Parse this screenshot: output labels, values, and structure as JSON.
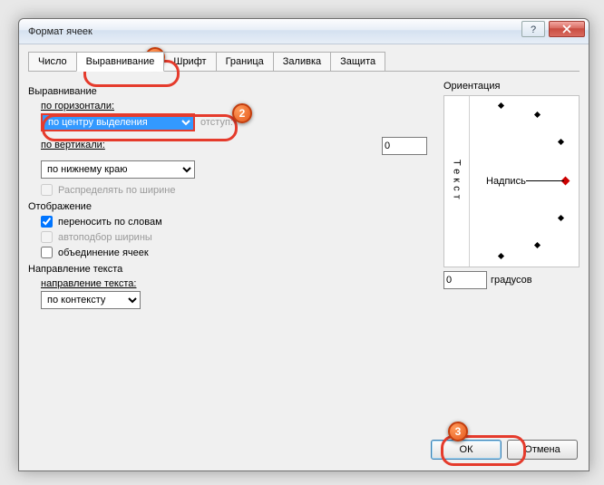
{
  "window": {
    "title": "Формат ячеек"
  },
  "tabs": [
    "Число",
    "Выравнивание",
    "Шрифт",
    "Граница",
    "Заливка",
    "Защита"
  ],
  "active_tab_index": 1,
  "align": {
    "group": "Выравнивание",
    "h_label": "по горизонтали:",
    "h_value": "по центру выделения",
    "indent_label": "отступ:",
    "indent_value": "0",
    "v_label": "по вертикали:",
    "v_value": "по нижнему краю",
    "justify_label": "Распределять по ширине"
  },
  "display": {
    "group": "Отображение",
    "wrap_label": "переносить по словам",
    "wrap_checked": true,
    "shrink_label": "автоподбор ширины",
    "shrink_checked": false,
    "merge_label": "объединение ячеек",
    "merge_checked": false
  },
  "dir": {
    "group": "Направление текста",
    "label": "направление текста:",
    "value": "по контексту"
  },
  "orient": {
    "group": "Ориентация",
    "vertical_text": "Текст",
    "diag_label": "Надпись",
    "deg_value": "0",
    "deg_label": "градусов"
  },
  "buttons": {
    "ok": "ОК",
    "cancel": "Отмена"
  },
  "markers": {
    "m1": "1",
    "m2": "2",
    "m3": "3"
  }
}
